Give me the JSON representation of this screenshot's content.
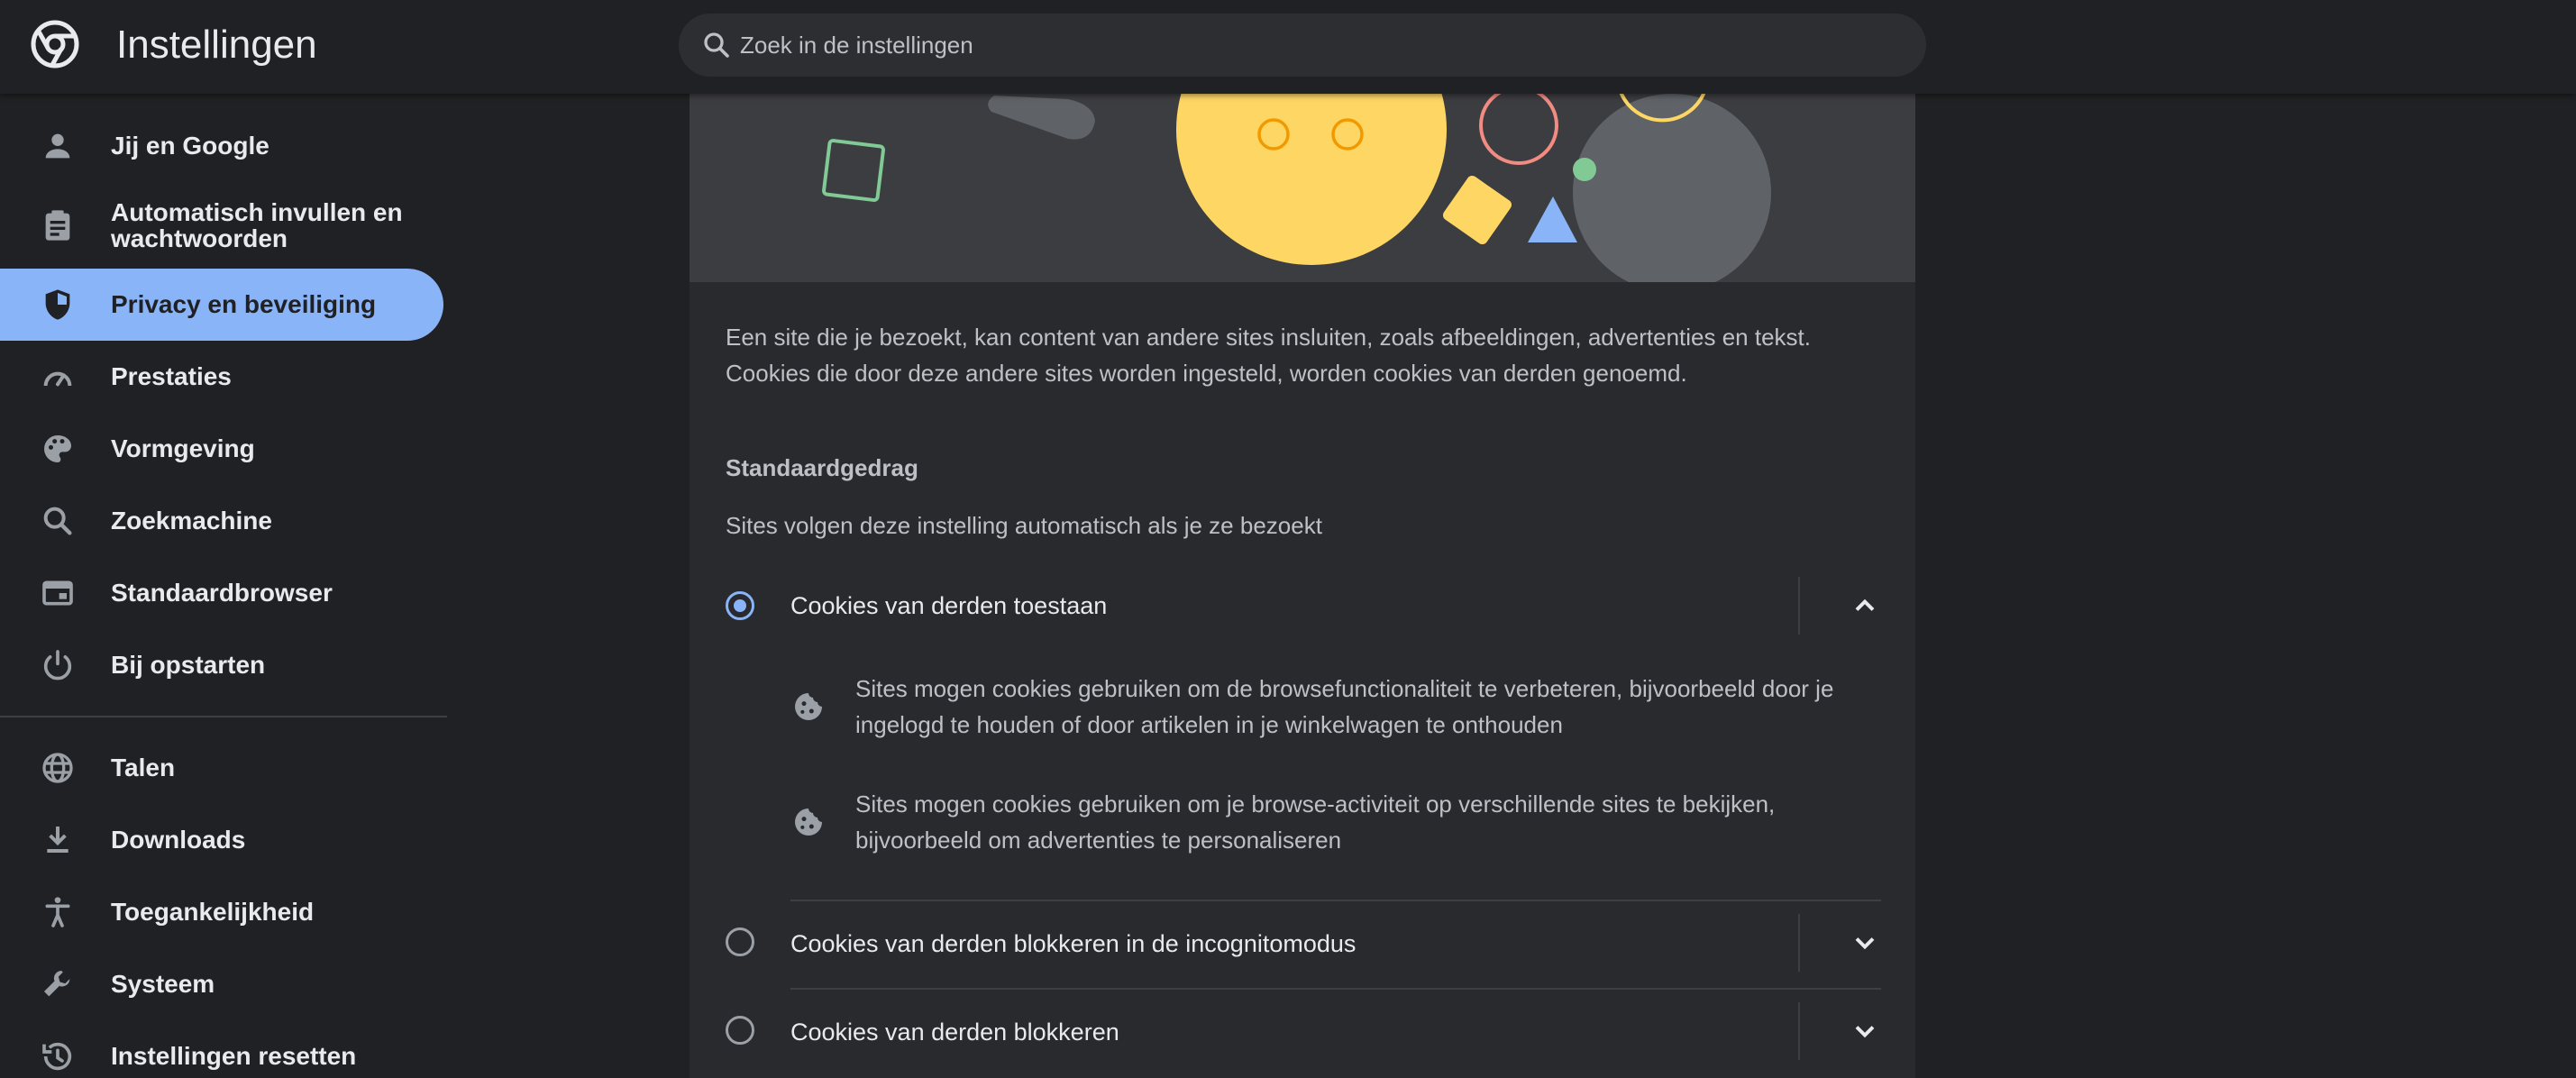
{
  "app": {
    "title": "Instellingen"
  },
  "search": {
    "placeholder": "Zoek in de instellingen"
  },
  "sidebar": {
    "items": [
      {
        "label": "Jij en Google",
        "icon": "person-icon",
        "active": false
      },
      {
        "label": "Automatisch invullen en wachtwoorden",
        "icon": "clipboard-icon",
        "active": false
      },
      {
        "label": "Privacy en beveiliging",
        "icon": "shield-icon",
        "active": true
      },
      {
        "label": "Prestaties",
        "icon": "speedometer-icon",
        "active": false
      },
      {
        "label": "Vormgeving",
        "icon": "palette-icon",
        "active": false
      },
      {
        "label": "Zoekmachine",
        "icon": "search-icon",
        "active": false
      },
      {
        "label": "Standaardbrowser",
        "icon": "browser-window-icon",
        "active": false
      },
      {
        "label": "Bij opstarten",
        "icon": "power-icon",
        "active": false
      },
      {
        "label": "Talen",
        "icon": "globe-icon",
        "active": false
      },
      {
        "label": "Downloads",
        "icon": "download-icon",
        "active": false
      },
      {
        "label": "Toegankelijkheid",
        "icon": "accessibility-icon",
        "active": false
      },
      {
        "label": "Systeem",
        "icon": "wrench-icon",
        "active": false
      },
      {
        "label": "Instellingen resetten",
        "icon": "history-icon",
        "active": false
      }
    ]
  },
  "main": {
    "intro": "Een site die je bezoekt, kan content van andere sites insluiten, zoals afbeeldingen, advertenties en tekst. Cookies die door deze andere sites worden ingesteld, worden cookies van derden genoemd.",
    "section_heading": "Standaardgedrag",
    "section_sub": "Sites volgen deze instelling automatisch als je ze bezoekt",
    "options": [
      {
        "label": "Cookies van derden toestaan",
        "selected": true,
        "expanded": true,
        "details": [
          "Sites mogen cookies gebruiken om de browsefunctionaliteit te verbeteren, bijvoorbeeld door je ingelogd te houden of door artikelen in je winkelwagen te onthouden",
          "Sites mogen cookies gebruiken om je browse-activiteit op verschillende sites te bekijken, bijvoorbeeld om advertenties te personaliseren"
        ]
      },
      {
        "label": "Cookies van derden blokkeren in de incognitomodus",
        "selected": false,
        "expanded": false
      },
      {
        "label": "Cookies van derden blokkeren",
        "selected": false,
        "expanded": false
      }
    ]
  },
  "colors": {
    "accent": "#8ab4f8",
    "background": "#202124",
    "card": "#292a2d",
    "text_primary": "#e8eaed",
    "text_secondary": "#bdc1c6"
  }
}
